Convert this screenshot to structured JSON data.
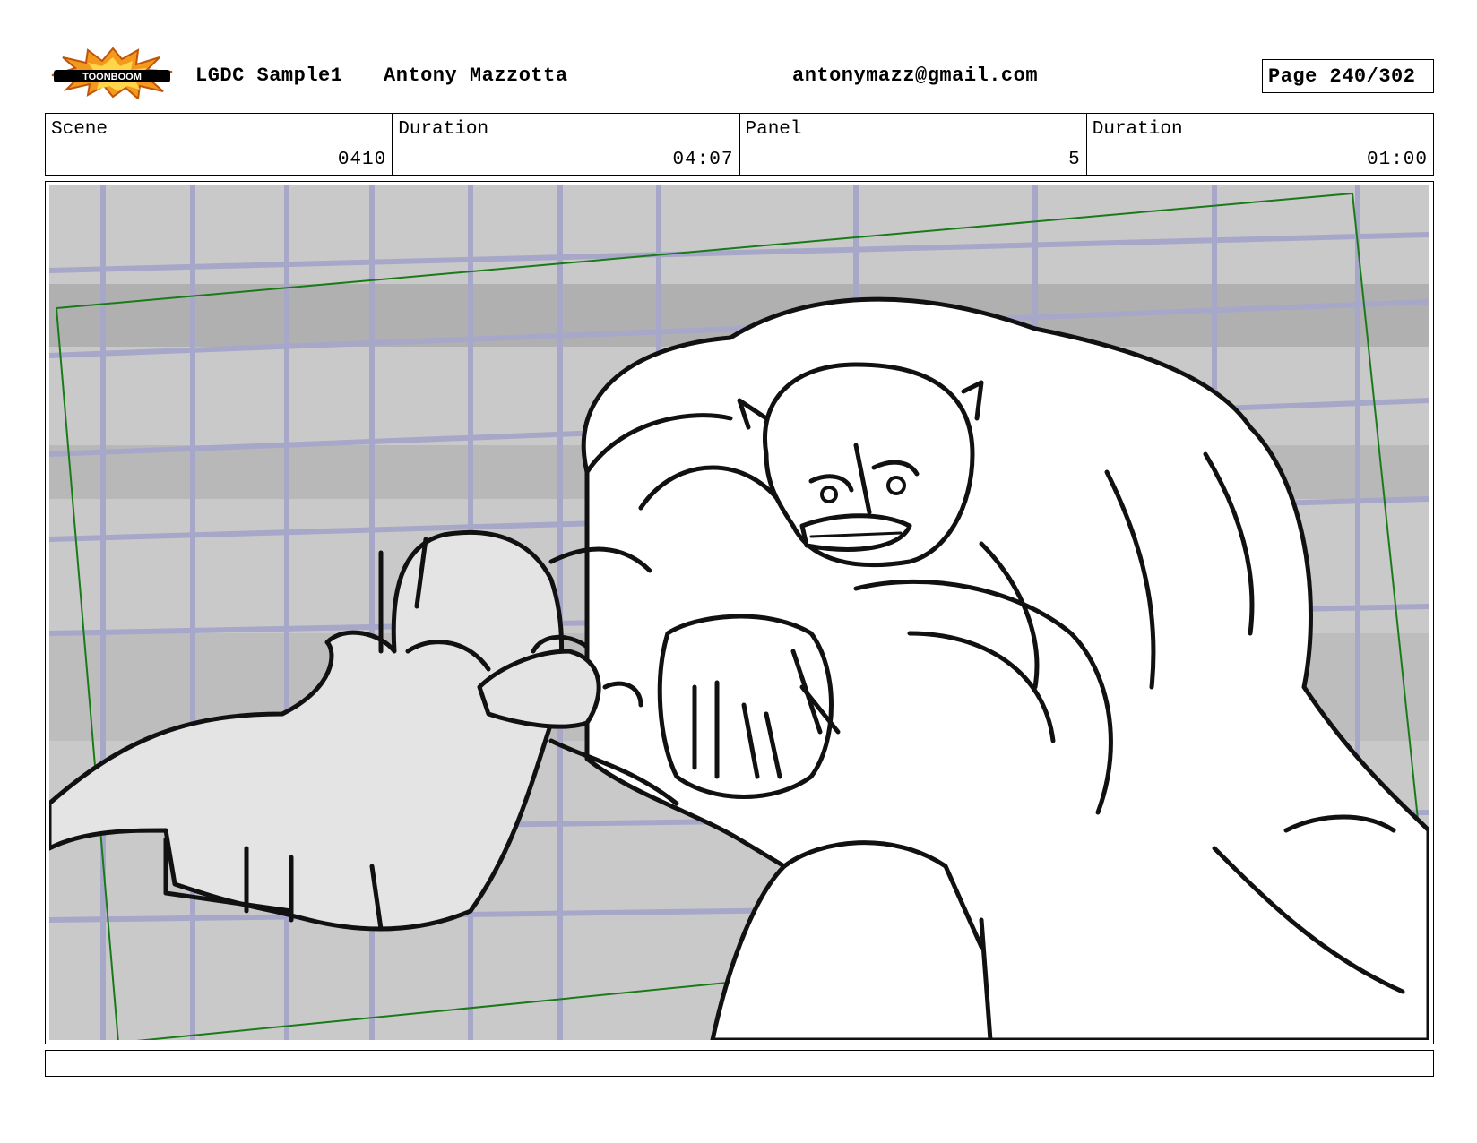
{
  "header": {
    "logo_text": "TOONBOOM",
    "project": "LGDC Sample1",
    "author": "Antony Mazzotta",
    "email": "antonymazz@gmail.com",
    "page_label": "Page 240/302"
  },
  "info": {
    "scene_label": "Scene",
    "scene_value": "0410",
    "scene_duration_label": "Duration",
    "scene_duration_value": "04:07",
    "panel_label": "Panel",
    "panel_value": "5",
    "panel_duration_label": "Duration",
    "panel_duration_value": "01:00"
  },
  "colors": {
    "camera_frame": "#1a7a1a",
    "background_lines": "#a7a7c9",
    "background_fill": "#b3b3b3",
    "ink": "#111111"
  },
  "caption": ""
}
